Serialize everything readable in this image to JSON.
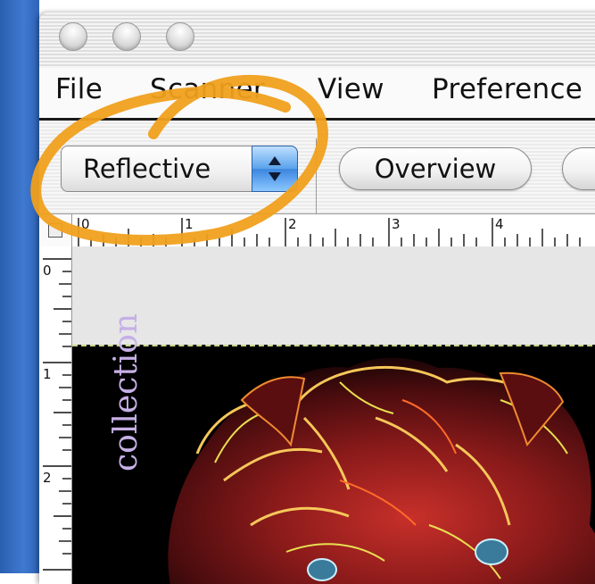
{
  "window": {
    "buttons": [
      "close",
      "minimize",
      "zoom"
    ]
  },
  "menu": {
    "items": [
      "File",
      "Scanner",
      "View",
      "Preference"
    ]
  },
  "toolbar": {
    "source_select": "Reflective",
    "overview_label": "Overview"
  },
  "rulers": {
    "horizontal_numbers": [
      "0",
      "1",
      "2",
      "3",
      "4"
    ],
    "vertical_numbers": [
      "0",
      "1",
      "2"
    ]
  },
  "preview": {
    "side_text": "collection"
  },
  "colors": {
    "accent_select": "#3b86df",
    "annotation_stroke": "#f0a01e",
    "preview_background": "#000000",
    "selection_border": "#c9d88c"
  },
  "icons": {
    "stepper": "up-down-arrows-icon"
  }
}
